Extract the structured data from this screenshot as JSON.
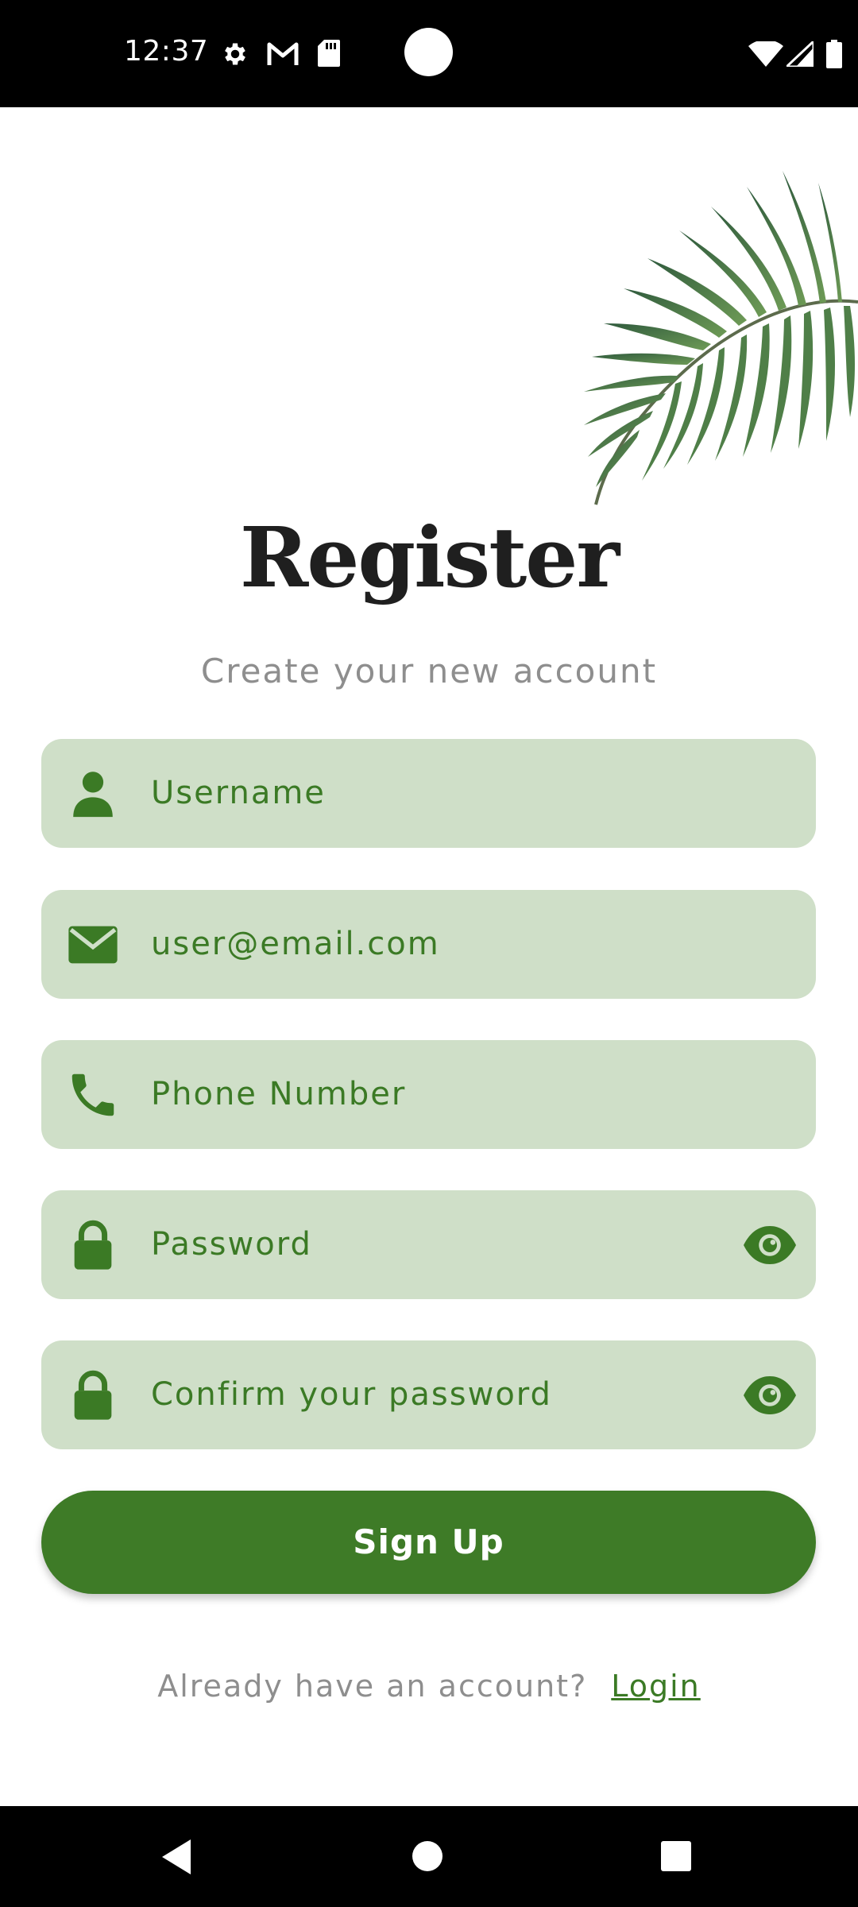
{
  "status_bar": {
    "time": "12:37",
    "icons": [
      "gear-icon",
      "gmail-icon",
      "sd-card-icon",
      "wifi-icon",
      "signal-icon",
      "battery-icon"
    ]
  },
  "header": {
    "title": "Register",
    "subtitle": "Create your new account"
  },
  "form": {
    "username": {
      "placeholder": "Username",
      "icon": "person-icon"
    },
    "email": {
      "value": "user@email.com",
      "icon": "envelope-icon"
    },
    "phone": {
      "placeholder": "Phone Number",
      "icon": "phone-icon"
    },
    "password": {
      "placeholder": "Password",
      "icon": "lock-icon",
      "toggle_icon": "eye-icon"
    },
    "confirm_password": {
      "placeholder": "Confirm your password",
      "icon": "lock-icon",
      "toggle_icon": "eye-icon"
    }
  },
  "signup_button": {
    "label": "Sign Up"
  },
  "footer": {
    "question": "Already have an account?",
    "login_link": "Login"
  },
  "nav_bar": {
    "icons": [
      "back-icon",
      "home-icon",
      "recents-icon"
    ]
  },
  "colors": {
    "accent": "#3e7b27",
    "field_bg": "#cfdfc8",
    "field_text": "#3b7a25",
    "subtitle": "#8e8e8e",
    "title": "#1f1f1f"
  }
}
